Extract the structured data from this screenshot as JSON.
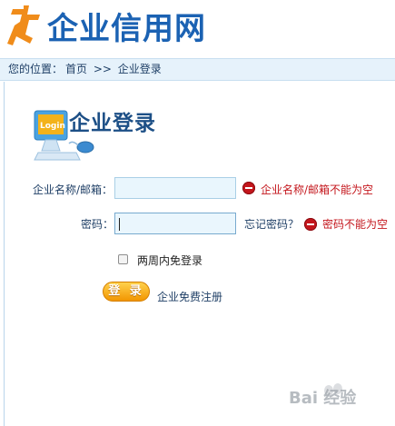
{
  "header": {
    "site_name": "企业信用网"
  },
  "breadcrumb": {
    "prefix": "您的位置：",
    "home": "首页",
    "separator": ">>",
    "current": "企业登录"
  },
  "page": {
    "title": "企业登录",
    "illustration_text": "Login"
  },
  "form": {
    "account_label": "企业名称/邮箱：",
    "account_value": "",
    "account_error": "企业名称/邮箱不能为空",
    "password_label": "密码：",
    "password_value": "",
    "forgot_link": "忘记密码？",
    "password_error": "密码不能为空",
    "remember_label": "两周内免登录",
    "remember_checked": false,
    "login_button": "登 录",
    "register_link": "企业免费注册"
  },
  "colors": {
    "brand_blue": "#1b62b3",
    "error_red": "#c4161c",
    "button_orange": "#f29600",
    "breadcrumb_bg": "#e6f2fb"
  },
  "watermark": {
    "text": "Bai 经验"
  }
}
